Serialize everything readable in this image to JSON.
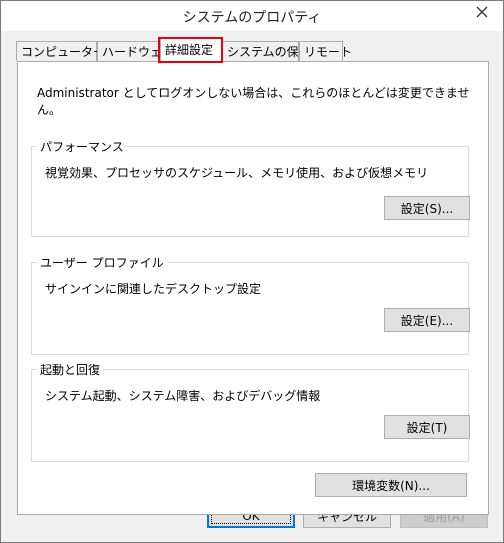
{
  "window": {
    "title": "システムのプロパティ",
    "close_glyph": "✕"
  },
  "tabs": [
    {
      "label": "コンピューター名",
      "active": false
    },
    {
      "label": "ハードウェア",
      "active": false
    },
    {
      "label": "詳細設定",
      "active": true
    },
    {
      "label": "システムの保護",
      "active": false
    },
    {
      "label": "リモート",
      "active": false
    }
  ],
  "panel": {
    "intro": "Administrator としてログオンしない場合は、これらのほとんどは変更できません。",
    "performance": {
      "title": "パフォーマンス",
      "description": "視覚効果、プロセッサのスケジュール、メモリ使用、および仮想メモリ",
      "button": "設定(S)..."
    },
    "user_profiles": {
      "title": "ユーザー プロファイル",
      "description": "サインインに関連したデスクトップ設定",
      "button": "設定(E)..."
    },
    "startup_recovery": {
      "title": "起動と回復",
      "description": "システム起動、システム障害、およびデバッグ情報",
      "button": "設定(T)"
    },
    "env_button": "環境変数(N)..."
  },
  "footer": {
    "ok": "OK",
    "cancel": "キャンセル",
    "apply": "適用(A)"
  },
  "colors": {
    "highlight": "#e60012",
    "default_button_border": "#0078d7",
    "dialog_background": "#f0f0f0"
  }
}
